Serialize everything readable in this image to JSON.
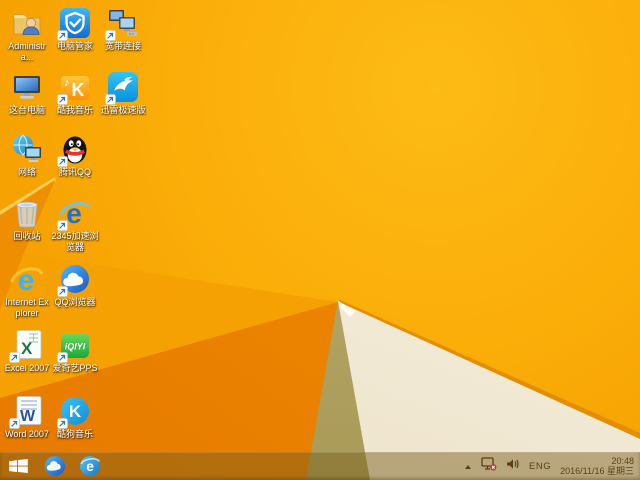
{
  "desktop": {
    "icons": [
      {
        "name": "administrator-folder",
        "label": "Administra..."
      },
      {
        "name": "this-pc",
        "label": "这台电脑"
      },
      {
        "name": "network",
        "label": "网络"
      },
      {
        "name": "recycle-bin",
        "label": "回收站"
      },
      {
        "name": "internet-explorer",
        "label": "Internet Explorer"
      },
      {
        "name": "excel-2007",
        "label": "Excel 2007"
      },
      {
        "name": "word-2007",
        "label": "Word 2007"
      },
      {
        "name": "tencent-pc-manager",
        "label": "电脑管家"
      },
      {
        "name": "kuwo-music",
        "label": "酷我音乐"
      },
      {
        "name": "tencent-qq",
        "label": "腾讯QQ"
      },
      {
        "name": "2345-browser",
        "label": "2345加速浏览器"
      },
      {
        "name": "qq-browser",
        "label": "QQ浏览器"
      },
      {
        "name": "iqiyi-pps",
        "label": "爱奇艺PPS"
      },
      {
        "name": "kugou-music",
        "label": "酷狗音乐"
      },
      {
        "name": "broadband-connection",
        "label": "宽带连接"
      },
      {
        "name": "xunlei-thunder",
        "label": "迅雷极速版"
      }
    ]
  },
  "taskbar": {
    "pinned": [
      {
        "name": "qq-browser"
      },
      {
        "name": "internet-explorer"
      }
    ],
    "tray": {
      "language": "ENG",
      "time": "20:48",
      "date": "2016/11/16 星期三"
    }
  },
  "colors": {
    "wallpaper_orange": "#fbad08",
    "wallpaper_dark_orange": "#ec8400",
    "wallpaper_cream": "#f2ead6",
    "wallpaper_olive": "#ac9c5a",
    "taskbar_tint": "#a98c50",
    "tray_text": "#5c3e14"
  }
}
